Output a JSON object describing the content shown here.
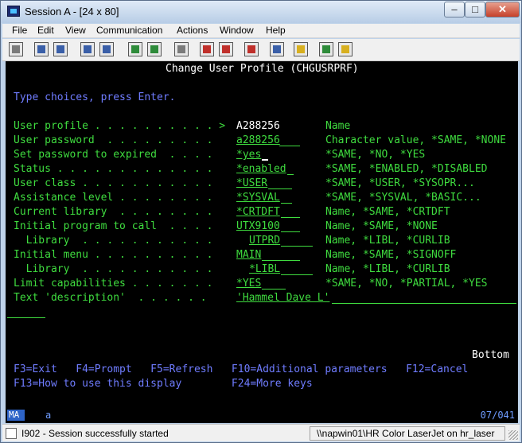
{
  "window": {
    "title": "Session A - [24 x 80]"
  },
  "menu": [
    "File",
    "Edit",
    "View",
    "Communication",
    "Actions",
    "Window",
    "Help"
  ],
  "toolbar_icons": [
    "print-icon",
    "copy-icon",
    "paste-icon",
    "send-icon",
    "receive-icon",
    "display-icon",
    "keypad-icon",
    "macro-icon",
    "record-icon",
    "play-icon",
    "stop-icon",
    "chart-icon",
    "clipboard-icon",
    "map-icon",
    "help-icon"
  ],
  "screen": {
    "title": "Change User Profile (CHGUSRPRF)",
    "instruction": "Type choices, press Enter.",
    "fields": [
      {
        "label": "User profile . . . . . . . . . . >",
        "value": "A288256",
        "help": "Name"
      },
      {
        "label": "User password  . . . . . . . . .",
        "value": "a288256",
        "help": "Character value, *SAME, *NONE"
      },
      {
        "label": "Set password to expired  . . . .",
        "value": "*yes",
        "help": "*SAME, *NO, *YES"
      },
      {
        "label": "Status . . . . . . . . . . . . .",
        "value": "*enabled",
        "help": "*SAME, *ENABLED, *DISABLED"
      },
      {
        "label": "User class . . . . . . . . . . .",
        "value": "*USER",
        "help": "*SAME, *USER, *SYSOPR..."
      },
      {
        "label": "Assistance level . . . . . . . .",
        "value": "*SYSVAL",
        "help": "*SAME, *SYSVAL, *BASIC..."
      },
      {
        "label": "Current library  . . . . . . . .",
        "value": "*CRTDFT",
        "help": "Name, *SAME, *CRTDFT"
      },
      {
        "label": "Initial program to call  . . . .",
        "value": "UTX9100",
        "help": "Name, *SAME, *NONE"
      },
      {
        "label": "  Library  . . . . . . . . . . .",
        "value": "UTPRD",
        "help": "Name, *LIBL, *CURLIB"
      },
      {
        "label": "Initial menu . . . . . . . . . .",
        "value": "MAIN",
        "help": "Name, *SAME, *SIGNOFF"
      },
      {
        "label": "  Library  . . . . . . . . . . .",
        "value": "*LIBL",
        "help": "Name, *LIBL, *CURLIB"
      },
      {
        "label": "Limit capabilities . . . . . . .",
        "value": "*YES",
        "help": "*SAME, *NO, *PARTIAL, *YES"
      },
      {
        "label": "Text 'description'  . . . . . .",
        "value": "'Hammel Dave L'",
        "help": ""
      }
    ],
    "bottom": "Bottom",
    "fkeys_1": "F3=Exit   F4=Prompt   F5=Refresh   F10=Additional parameters   F12=Cancel",
    "fkeys_2": "F13=How to use this display        F24=More keys"
  },
  "oia": {
    "indicator": "MA",
    "mode": "a",
    "cursor": "07/041"
  },
  "status": {
    "message": "I902 - Session successfully started",
    "printer": "\\\\napwin01\\HR Color LaserJet on hr_laser"
  }
}
